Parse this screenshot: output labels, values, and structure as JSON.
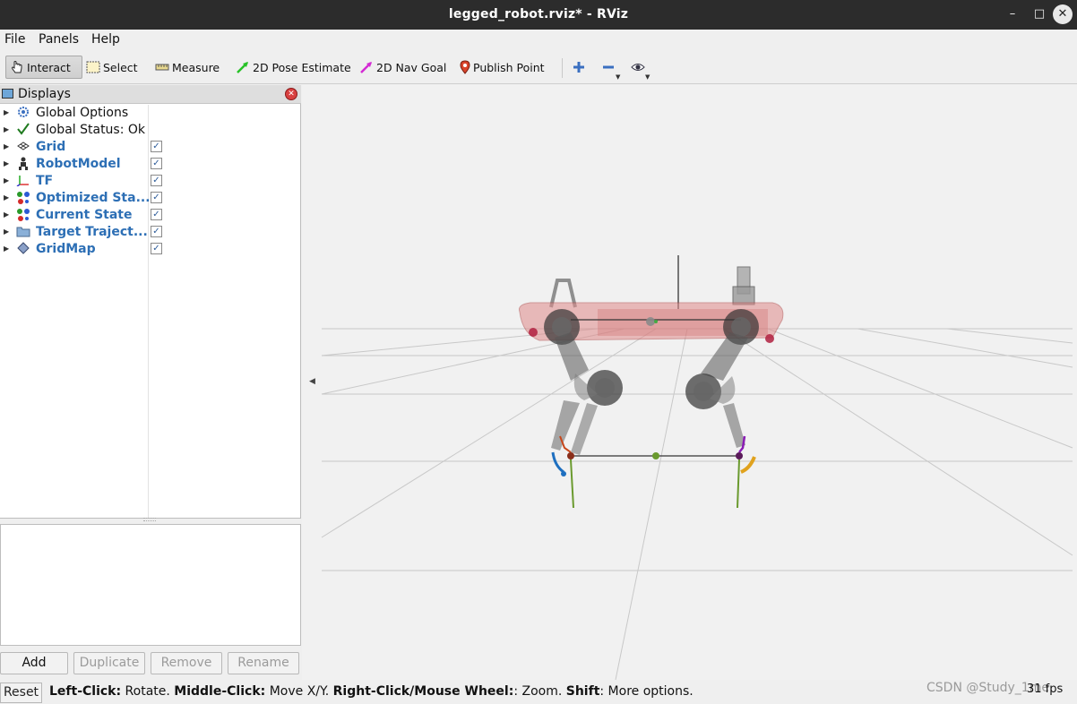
{
  "window": {
    "title": "legged_robot.rviz* - RViz",
    "minimize_glyph": "–",
    "maximize_glyph": "□",
    "close_glyph": "✕"
  },
  "menu": {
    "file": "File",
    "panels": "Panels",
    "help": "Help"
  },
  "toolbar": {
    "interact": "Interact",
    "select": "Select",
    "measure": "Measure",
    "pose_estimate": "2D Pose Estimate",
    "nav_goal": "2D Nav Goal",
    "publish_point": "Publish Point"
  },
  "displays": {
    "title": "Displays",
    "items": [
      {
        "label": "Global Options",
        "icon": "gear-icon",
        "bold": false,
        "checked": null
      },
      {
        "label": "Global Status: Ok",
        "icon": "check-icon",
        "bold": false,
        "checked": null
      },
      {
        "label": "Grid",
        "icon": "grid-icon",
        "bold": true,
        "checked": true
      },
      {
        "label": "RobotModel",
        "icon": "robot-icon",
        "bold": true,
        "checked": true
      },
      {
        "label": "TF",
        "icon": "axes-icon",
        "bold": true,
        "checked": true
      },
      {
        "label": "Optimized Sta...",
        "icon": "marker-array-icon",
        "bold": true,
        "checked": true
      },
      {
        "label": "Current State",
        "icon": "marker-array-icon",
        "bold": true,
        "checked": true
      },
      {
        "label": "Target Traject...",
        "icon": "folder-icon",
        "bold": true,
        "checked": true
      },
      {
        "label": "GridMap",
        "icon": "gridmap-icon",
        "bold": true,
        "checked": true
      }
    ]
  },
  "panel_buttons": {
    "add": "Add",
    "duplicate": "Duplicate",
    "remove": "Remove",
    "rename": "Rename"
  },
  "status": {
    "reset": "Reset",
    "hint_left_click": "Left-Click:",
    "hint_rotate": " Rotate. ",
    "hint_middle_click": "Middle-Click:",
    "hint_move": " Move X/Y. ",
    "hint_right_click": "Right-Click/Mouse Wheel:",
    "hint_zoom": ": Zoom. ",
    "hint_shift": "Shift",
    "hint_more": ": More options.",
    "watermark": "CSDN @Study_1me",
    "fps": "31 fps"
  },
  "colors": {
    "accent_blue": "#2d6fb5",
    "robot_body": "#e08a8a",
    "grid_line": "#c8c8c8"
  }
}
